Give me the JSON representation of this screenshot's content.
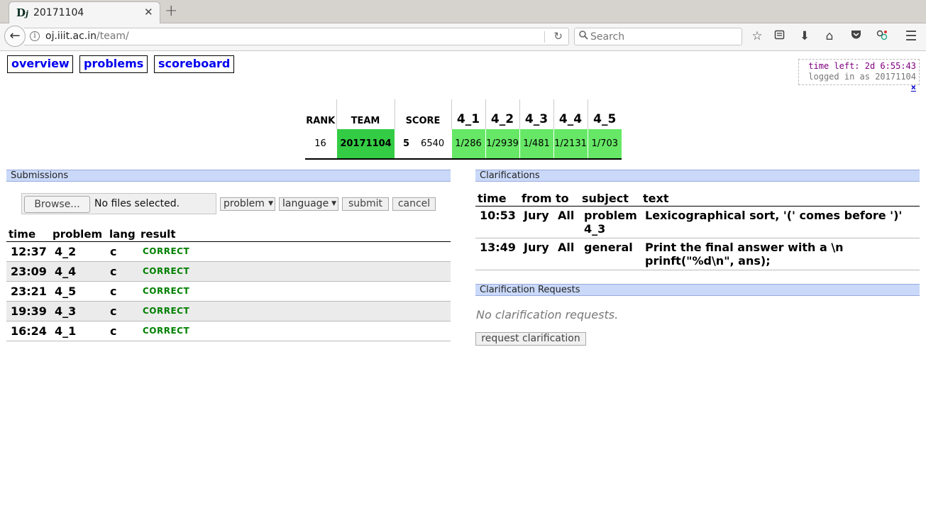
{
  "browser": {
    "tab_title": "20171104",
    "favicon_text": "Dj",
    "url_host": "oj.iiit.ac.in",
    "url_path": "/team/",
    "search_placeholder": "Search"
  },
  "nav": {
    "overview": "overview",
    "problems": "problems",
    "scoreboard": "scoreboard"
  },
  "status": {
    "time_left": "time left: 2d 6:55:43",
    "logged_in": "logged in as 20171104",
    "logout": "×"
  },
  "scoreboard": {
    "headers": {
      "rank": "RANK",
      "team": "TEAM",
      "score": "SCORE"
    },
    "problems": [
      "4_1",
      "4_2",
      "4_3",
      "4_4",
      "4_5"
    ],
    "row": {
      "rank": "16",
      "team": "20171104",
      "solved": "5",
      "penalty": "6540",
      "cells": [
        "1/286",
        "1/2939",
        "1/481",
        "1/2131",
        "1/703"
      ]
    },
    "colors": {
      "team_bg": "#33cc44",
      "solved_bg": "#66e866"
    }
  },
  "submissions": {
    "heading": "Submissions",
    "form": {
      "browse": "Browse...",
      "no_files": "No files selected.",
      "problem": "problem",
      "language": "language",
      "submit": "submit",
      "cancel": "cancel"
    },
    "columns": [
      "time",
      "problem",
      "lang",
      "result"
    ],
    "rows": [
      {
        "time": "12:37",
        "problem": "4_2",
        "lang": "c",
        "result": "CORRECT"
      },
      {
        "time": "23:09",
        "problem": "4_4",
        "lang": "c",
        "result": "CORRECT"
      },
      {
        "time": "23:21",
        "problem": "4_5",
        "lang": "c",
        "result": "CORRECT"
      },
      {
        "time": "19:39",
        "problem": "4_3",
        "lang": "c",
        "result": "CORRECT"
      },
      {
        "time": "16:24",
        "problem": "4_1",
        "lang": "c",
        "result": "CORRECT"
      }
    ]
  },
  "clarifications": {
    "heading": "Clarifications",
    "columns": [
      "time",
      "from",
      "to",
      "subject",
      "text"
    ],
    "rows": [
      {
        "time": "10:53",
        "from": "Jury",
        "to": "All",
        "subject": "problem 4_3",
        "text": "Lexicographical sort, '(' comes before ')'"
      },
      {
        "time": "13:49",
        "from": "Jury",
        "to": "All",
        "subject": "general",
        "text": "Print the final answer with a \\n prinft(\"%d\\n\", ans);"
      }
    ]
  },
  "clarification_requests": {
    "heading": "Clarification Requests",
    "empty": "No clarification requests.",
    "button": "request clarification"
  }
}
